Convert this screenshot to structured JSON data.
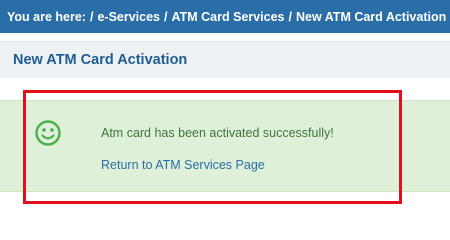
{
  "breadcrumb": {
    "prefix": "You are here:",
    "separator": "/",
    "items": [
      "e-Services",
      "ATM Card Services",
      "New ATM Card Activation"
    ]
  },
  "page": {
    "title": "New ATM Card Activation"
  },
  "alert": {
    "icon": "smile-icon",
    "message": "Atm card has been activated successfully!",
    "link_label": "Return to ATM Services Page"
  },
  "colors": {
    "breadcrumb_bg": "#2a6ea8",
    "success_bg": "#dff0d8",
    "success_text": "#3c763d",
    "highlight_border": "#e3101b"
  }
}
